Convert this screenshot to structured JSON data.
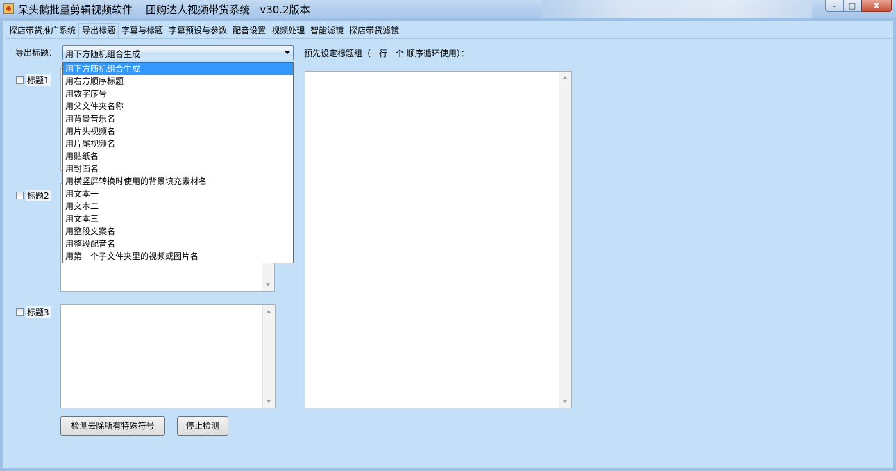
{
  "window": {
    "title": "呆头鹅批量剪辑视频软件    团购达人视频带货系统   v30.2版本",
    "minimize": "–",
    "maximize": "□",
    "close": "X"
  },
  "tabs": [
    {
      "label": "探店带货推广系统"
    },
    {
      "label": "导出标题"
    },
    {
      "label": "字幕与标题"
    },
    {
      "label": "字幕预设与参数"
    },
    {
      "label": "配音设置"
    },
    {
      "label": "视频处理"
    },
    {
      "label": "智能滤镜"
    },
    {
      "label": "探店带货滤镜"
    }
  ],
  "export_title": {
    "label": "导出标题：",
    "selected": "用下方随机组合生成",
    "options": [
      "用下方随机组合生成",
      "用右方顺序标题",
      "用数字序号",
      "用父文件夹名称",
      "用背景音乐名",
      "用片头视频名",
      "用片尾视频名",
      "用贴纸名",
      "用封面名",
      "用横竖屏转换时使用的背景填充素材名",
      "用文本一",
      "用文本二",
      "用文本三",
      "用整段文案名",
      "用整段配音名",
      "用第一个子文件夹里的视频或图片名"
    ]
  },
  "preset_label": "预先设定标题组（一行一个 顺序循环使用）：",
  "checkboxes": [
    {
      "label": "标题1"
    },
    {
      "label": "标题2"
    },
    {
      "label": "标题3"
    }
  ],
  "buttons": {
    "detect_remove": "检测去除所有特殊符号",
    "stop_detect": "停止检测"
  }
}
